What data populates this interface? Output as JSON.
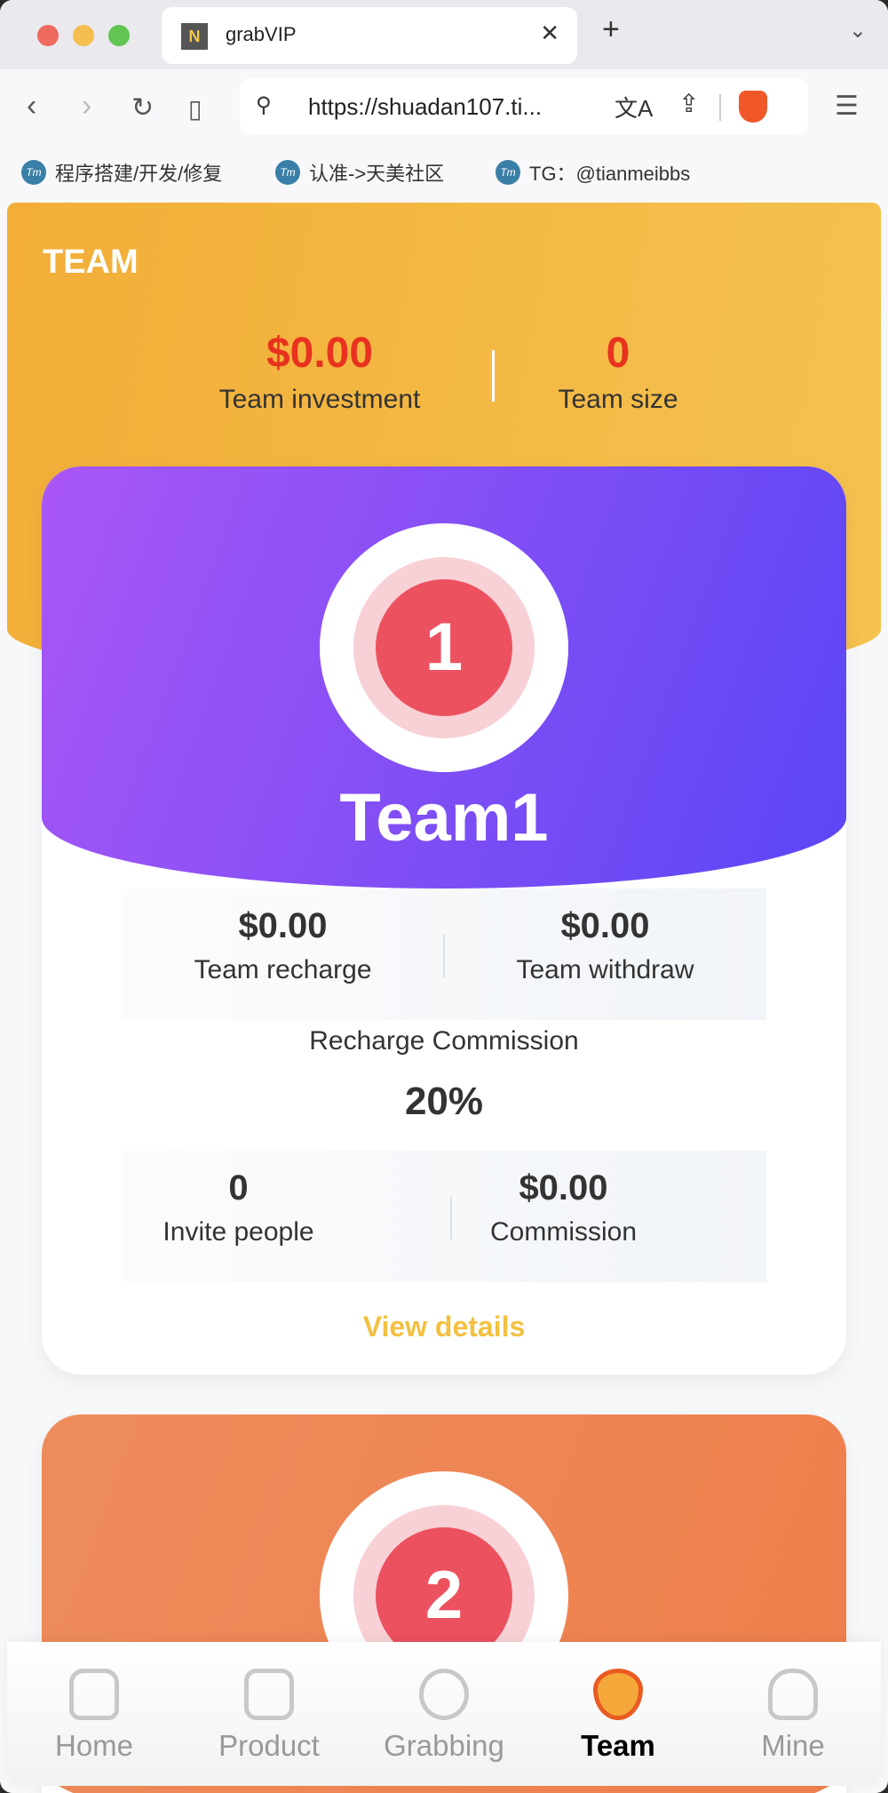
{
  "browser": {
    "tab_title": "grabVIP",
    "url": "https://shuadan107.ti...",
    "bookmarks": [
      "程序搭建/开发/修复",
      "认准->天美社区",
      "TG：@tianmeibbs"
    ]
  },
  "header": {
    "title": "TEAM",
    "investment_value": "$0.00",
    "investment_label": "Team investment",
    "size_value": "0",
    "size_label": "Team size"
  },
  "cards": [
    {
      "rank": "1",
      "name": "Team1",
      "gradient": [
        "#a957f5",
        "#5a46f5"
      ],
      "recharge_value": "$0.00",
      "recharge_label": "Team recharge",
      "withdraw_value": "$0.00",
      "withdraw_label": "Team withdraw",
      "commission_label": "Recharge Commission",
      "commission_rate": "20%",
      "invite_value": "0",
      "invite_label": "Invite people",
      "commission_value": "$0.00",
      "commission_value_label": "Commission",
      "details_label": "View details"
    },
    {
      "rank": "2",
      "gradient": [
        "#ee8c5c",
        "#ef7f4c"
      ]
    }
  ],
  "tabbar": {
    "items": [
      {
        "label": "Home",
        "icon": "home-icon"
      },
      {
        "label": "Product",
        "icon": "box-icon"
      },
      {
        "label": "Grabbing",
        "icon": "trend-icon"
      },
      {
        "label": "Team",
        "icon": "heart-handshake-icon",
        "active": true
      },
      {
        "label": "Mine",
        "icon": "user-icon"
      }
    ]
  },
  "colors": {
    "accent": "#f4c040",
    "value_red": "#e8321f",
    "active_tab": "#f07a22"
  }
}
